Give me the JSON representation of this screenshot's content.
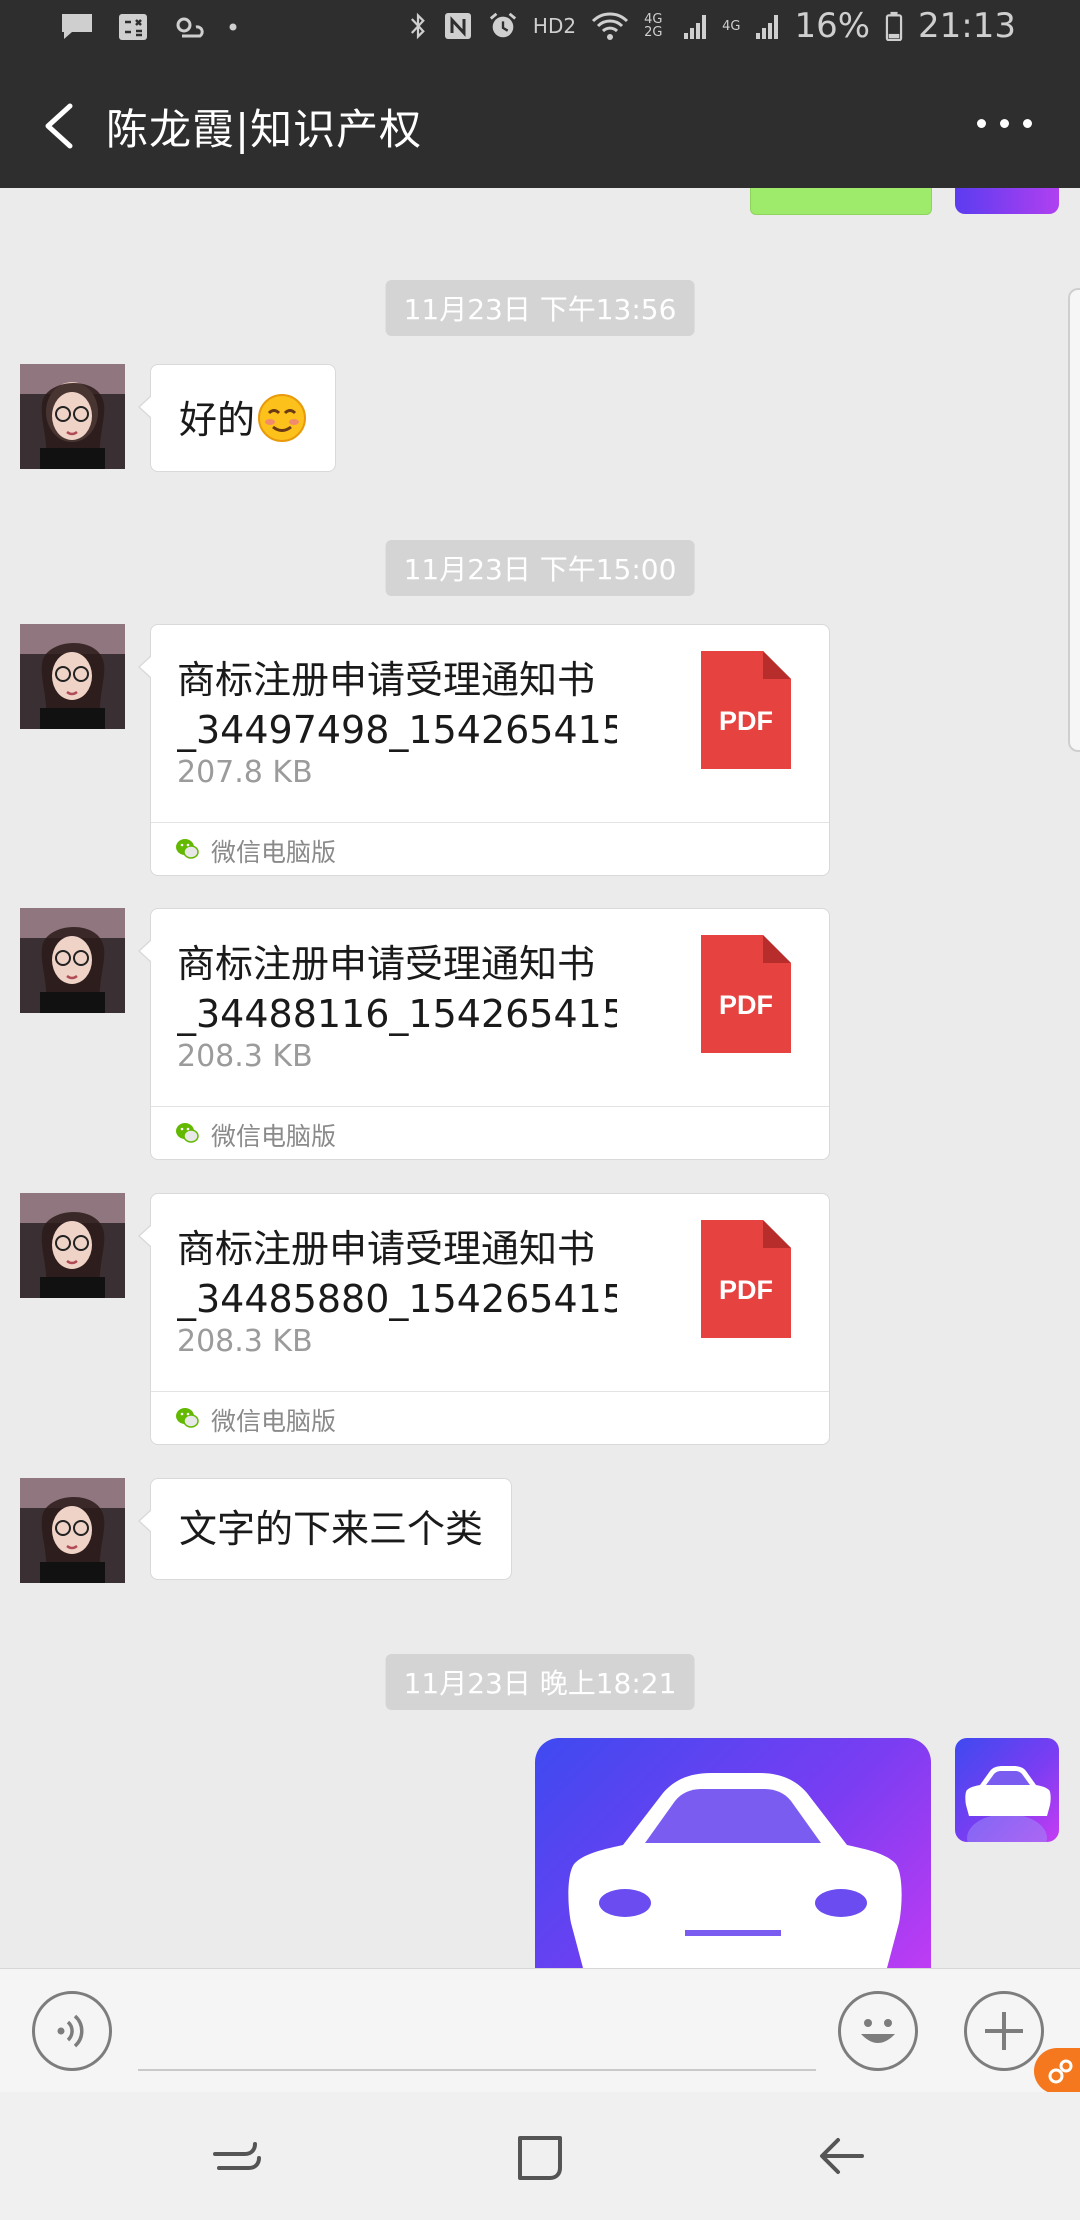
{
  "status_bar": {
    "network": "HD2",
    "signal_1": "4G 2G",
    "signal_2": "4G",
    "battery": "16%",
    "time": "21:13"
  },
  "header": {
    "title": "陈龙霞|知识产权"
  },
  "messages": [
    {
      "type": "timestamp",
      "text": "11月23日 下午13:56"
    },
    {
      "type": "text",
      "sender": "other",
      "text": "好的",
      "emoji": "blushing-face"
    },
    {
      "type": "timestamp",
      "text": "11月23日 下午15:00"
    },
    {
      "type": "file",
      "sender": "other",
      "name_line1": "商标注册申请受理通知书",
      "name_line2": "_34497498_154265415…",
      "size": "207.8 KB",
      "badge": "PDF",
      "source": "微信电脑版"
    },
    {
      "type": "file",
      "sender": "other",
      "name_line1": "商标注册申请受理通知书",
      "name_line2": "_34488116_154265415…",
      "size": "208.3 KB",
      "badge": "PDF",
      "source": "微信电脑版"
    },
    {
      "type": "file",
      "sender": "other",
      "name_line1": "商标注册申请受理通知书",
      "name_line2": "_34485880_154265415…",
      "size": "208.3 KB",
      "badge": "PDF",
      "source": "微信电脑版"
    },
    {
      "type": "text",
      "sender": "other",
      "text": "文字的下来三个类"
    },
    {
      "type": "timestamp",
      "text": "11月23日 晚上18:21"
    },
    {
      "type": "image",
      "sender": "self",
      "subject": "car-logo-icon"
    }
  ],
  "colors": {
    "header_bg": "#2e2e2e",
    "chat_bg": "#ebebeb",
    "pdf_red": "#e64340",
    "self_bubble_green": "#9eea6a",
    "logo_gradient_start": "#3e4af0",
    "logo_gradient_end": "#c63cf3"
  },
  "input_bar": {
    "left_icon": "voice-icon",
    "emoji_icon": "smiley-icon",
    "plus_icon": "plus-icon"
  }
}
